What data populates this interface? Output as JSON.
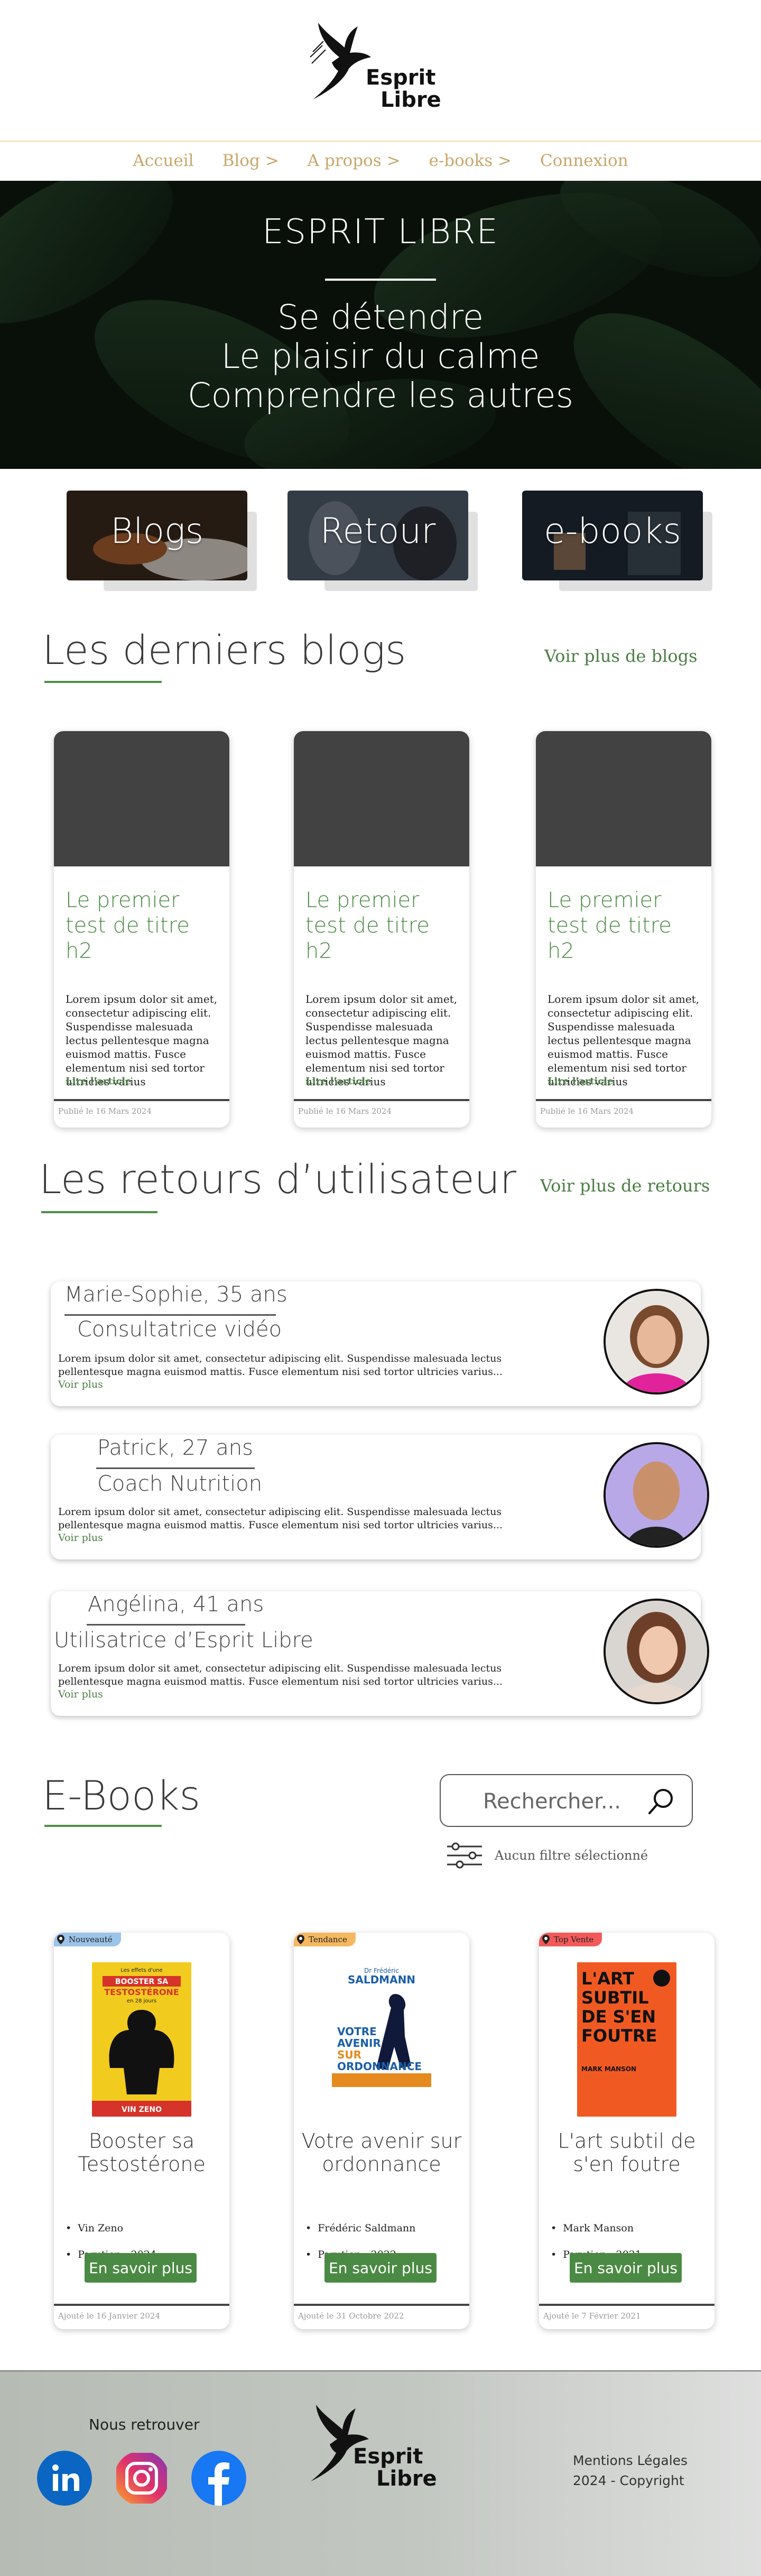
{
  "brand": {
    "line1": "Esprit",
    "line2": "Libre"
  },
  "nav": {
    "items": [
      {
        "label": "Accueil"
      },
      {
        "label": "Blog >"
      },
      {
        "label": "A propos >"
      },
      {
        "label": "e-books >"
      },
      {
        "label": "Connexion"
      }
    ]
  },
  "hero": {
    "title": "ESPRIT LIBRE",
    "lines": [
      "Se détendre",
      "Le plaisir du calme",
      "Comprendre les autres"
    ]
  },
  "tiles": [
    {
      "label": "Blogs"
    },
    {
      "label": "Retour"
    },
    {
      "label": "e-books"
    }
  ],
  "blogs": {
    "title": "Les derniers blogs",
    "more": "Voir plus de blogs",
    "cards": [
      {
        "title": "Le premier test de titre h2",
        "text": "Lorem ipsum dolor sit amet, consectetur adipiscing elit. Suspendisse malesuada lectus pellentesque magna euismod mattis. Fusce elementum nisi sed tortor ultricies varius",
        "link": "Lire l'article",
        "date": "Publié le 16 Mars 2024"
      },
      {
        "title": "Le premier test de titre h2",
        "text": "Lorem ipsum dolor sit amet, consectetur adipiscing elit. Suspendisse malesuada lectus pellentesque magna euismod mattis. Fusce elementum nisi sed tortor ultricies varius",
        "link": "Lire l'article",
        "date": "Publié le 16 Mars 2024"
      },
      {
        "title": "Le premier test de titre h2",
        "text": "Lorem ipsum dolor sit amet, consectetur adipiscing elit. Suspendisse malesuada lectus pellentesque magna euismod mattis. Fusce elementum nisi sed tortor ultricies varius",
        "link": "Lire l'article",
        "date": "Publié le 16 Mars 2024"
      }
    ]
  },
  "reviews": {
    "title": "Les retours d’utilisateur",
    "more": "Voir plus de retours",
    "items": [
      {
        "name": "Marie-Sophie, 35 ans",
        "role": "Consultatrice vidéo",
        "text": "Lorem ipsum dolor sit amet, consectetur adipiscing elit. Suspendisse malesuada lectus pellentesque magna euismod mattis. Fusce elementum nisi sed tortor ultricies varius...",
        "more": "Voir plus"
      },
      {
        "name": "Patrick, 27 ans",
        "role": "Coach Nutrition",
        "text": "Lorem ipsum dolor sit amet, consectetur adipiscing elit. Suspendisse malesuada lectus pellentesque magna euismod mattis. Fusce elementum nisi sed tortor ultricies varius...",
        "more": "Voir plus"
      },
      {
        "name": "Angélina, 41 ans",
        "role": "Utilisatrice d’Esprit Libre",
        "text": "Lorem ipsum dolor sit amet, consectetur adipiscing elit. Suspendisse malesuada lectus pellentesque magna euismod mattis. Fusce elementum nisi sed tortor ultricies varius...",
        "more": "Voir plus"
      }
    ]
  },
  "ebooks": {
    "title": "E-Books",
    "search_placeholder": "Rechercher...",
    "filter_text": "Aucun filtre sélectionné",
    "items": [
      {
        "badge": "Nouveauté",
        "badge_color": "#9cc3e8",
        "title": "Booster sa Testostérone",
        "author": "Vin Zeno",
        "year": "Parution : 2024",
        "button": "En savoir plus",
        "date": "Ajouté le 16 Janvier 2024",
        "cover_lines": [
          "Les effets d'une",
          "BOOSTER SA",
          "TESTOSTÉRONE",
          "en 28 jours",
          "VIN ZENO"
        ]
      },
      {
        "badge": "Tendance",
        "badge_color": "#f4b860",
        "title": "Votre avenir sur ordonnance",
        "author": "Frédéric Saldmann",
        "year": "Parution : 2022",
        "button": "En savoir plus",
        "date": "Ajouté le 31 Octobre 2022",
        "cover_lines": [
          "Dr Frédéric",
          "SALDMANN",
          "VOTRE",
          "AVENIR",
          "SUR",
          "ORDONNANCE"
        ]
      },
      {
        "badge": "Top Vente",
        "badge_color": "#f25a5a",
        "title": "L'art subtil de s'en foutre",
        "author": "Mark Manson",
        "year": "Parution : 2021",
        "button": "En savoir plus",
        "date": "Ajouté le 7 Février 2021",
        "cover_lines": [
          "L'ART",
          "SUBTIL",
          "DE S'EN",
          "FOUTRE",
          "MARK MANSON"
        ]
      }
    ]
  },
  "footer": {
    "follow": "Nous retrouver",
    "legal": "Mentions Légales",
    "copyright": "2024 - Copyright",
    "social": [
      "linkedin-icon",
      "instagram-icon",
      "facebook-icon"
    ]
  },
  "colors": {
    "accent_green": "#4b8a44",
    "nav_gold": "#c9a66a",
    "header_rule": "#f0d9a8"
  }
}
